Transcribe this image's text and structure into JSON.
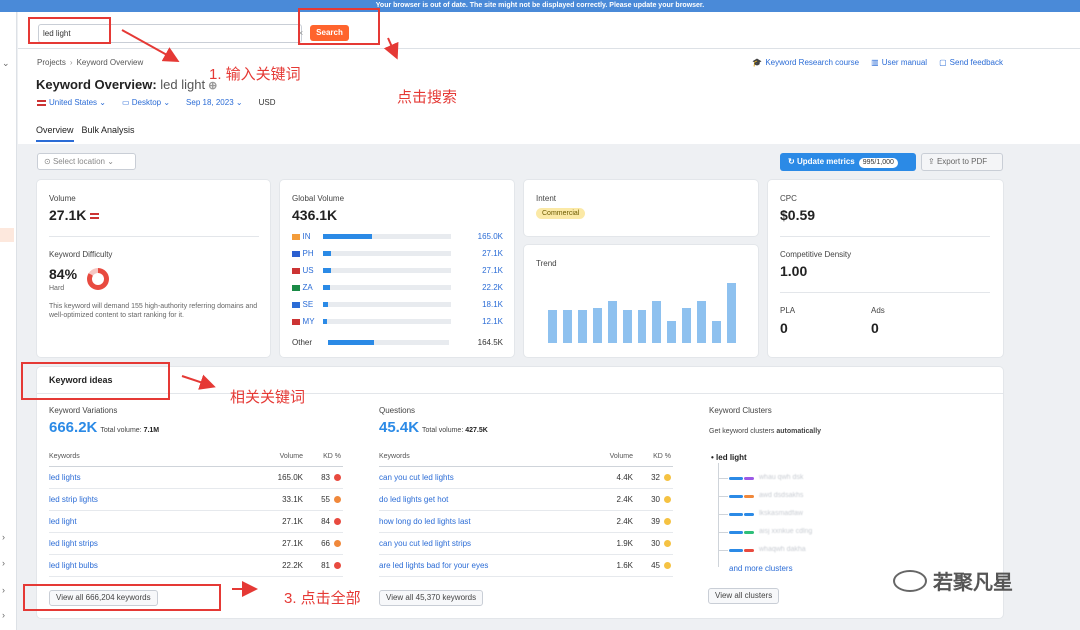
{
  "banner": "Your browser is out of date. The site might not be displayed correctly. Please update your browser.",
  "search": {
    "value": "led light",
    "button": "Search"
  },
  "breadcrumb": {
    "root": "Projects",
    "current": "Keyword Overview"
  },
  "title": {
    "prefix": "Keyword Overview:",
    "keyword": "led light"
  },
  "filters": {
    "country": "United States",
    "device": "Desktop",
    "date": "Sep 18, 2023",
    "currency": "USD"
  },
  "tabs": [
    "Overview",
    "Bulk Analysis"
  ],
  "header_links": [
    "Keyword Research course",
    "User manual",
    "Send feedback"
  ],
  "toolbar": {
    "location": "Select location",
    "update": "Update metrics",
    "update_count": "995/1,000",
    "export": "Export to PDF"
  },
  "volume": {
    "label": "Volume",
    "value": "27.1K"
  },
  "kd": {
    "label": "Keyword Difficulty",
    "value": "84%",
    "level": "Hard",
    "desc": "This keyword will demand 155 high-authority referring domains and well-optimized content to start ranking for it.",
    "percent": 84
  },
  "global_volume": {
    "label": "Global Volume",
    "value": "436.1K",
    "rows": [
      {
        "code": "IN",
        "val": "165.0K",
        "fill": 0.38,
        "flag": "#f39c3a"
      },
      {
        "code": "PH",
        "val": "27.1K",
        "fill": 0.06,
        "flag": "#2b5fd0"
      },
      {
        "code": "US",
        "val": "27.1K",
        "fill": 0.06,
        "flag": "#c33"
      },
      {
        "code": "ZA",
        "val": "22.2K",
        "fill": 0.05,
        "flag": "#1a8a46"
      },
      {
        "code": "SE",
        "val": "18.1K",
        "fill": 0.04,
        "flag": "#2b6cd6"
      },
      {
        "code": "MY",
        "val": "12.1K",
        "fill": 0.03,
        "flag": "#c33"
      }
    ],
    "other": {
      "label": "Other",
      "val": "164.5K",
      "fill": 0.38
    }
  },
  "intent": {
    "label": "Intent",
    "value": "Commercial"
  },
  "trend": {
    "label": "Trend",
    "values": [
      0.52,
      0.52,
      0.52,
      0.55,
      0.65,
      0.52,
      0.52,
      0.65,
      0.35,
      0.55,
      0.65,
      0.35,
      0.93
    ]
  },
  "cpc": {
    "label": "CPC",
    "value": "$0.59"
  },
  "competitive_density": {
    "label": "Competitive Density",
    "value": "1.00"
  },
  "pla": {
    "label": "PLA",
    "value": "0"
  },
  "ads": {
    "label": "Ads",
    "value": "0"
  },
  "keyword_ideas": {
    "title": "Keyword ideas",
    "variations": {
      "label": "Keyword Variations",
      "count": "666.2K",
      "total_label": "Total volume:",
      "total": "7.1M",
      "headers": [
        "Keywords",
        "Volume",
        "KD %"
      ],
      "rows": [
        {
          "kw": "led lights",
          "vol": "165.0K",
          "kd": "83",
          "color": "#e84a3f"
        },
        {
          "kw": "led strip lights",
          "vol": "33.1K",
          "kd": "55",
          "color": "#f0883b"
        },
        {
          "kw": "led light",
          "vol": "27.1K",
          "kd": "84",
          "color": "#e84a3f"
        },
        {
          "kw": "led light strips",
          "vol": "27.1K",
          "kd": "66",
          "color": "#f0883b"
        },
        {
          "kw": "led light bulbs",
          "vol": "22.2K",
          "kd": "81",
          "color": "#e84a3f"
        }
      ],
      "view_all": "View all 666,204 keywords"
    },
    "questions": {
      "label": "Questions",
      "count": "45.4K",
      "total_label": "Total volume:",
      "total": "427.5K",
      "headers": [
        "Keywords",
        "Volume",
        "KD %"
      ],
      "rows": [
        {
          "kw": "can you cut led lights",
          "vol": "4.4K",
          "kd": "32",
          "color": "#f5c242"
        },
        {
          "kw": "do led lights get hot",
          "vol": "2.4K",
          "kd": "30",
          "color": "#f5c242"
        },
        {
          "kw": "how long do led lights last",
          "vol": "2.4K",
          "kd": "39",
          "color": "#f5c242"
        },
        {
          "kw": "can you cut led light strips",
          "vol": "1.9K",
          "kd": "30",
          "color": "#f5c242"
        },
        {
          "kw": "are led lights bad for your eyes",
          "vol": "1.6K",
          "kd": "45",
          "color": "#f5c242"
        }
      ],
      "view_all": "View all 45,370 keywords"
    },
    "clusters": {
      "label": "Keyword Clusters",
      "desc_prefix": "Get keyword clusters",
      "desc_bold": "automatically",
      "root": "led light",
      "items": [
        "whau qwh dsk",
        "awd dsdsakhs",
        "lkskasmadfaw",
        "aisj xxnkue cdlng",
        "whaqwh dakha"
      ],
      "more": "and more clusters",
      "view_all": "View all clusters"
    }
  },
  "annotations": {
    "step1": "1. 输入关键词",
    "step2": "点击搜索",
    "related": "相关关键词",
    "step3": "3. 点击全部",
    "watermark": "若聚凡星"
  }
}
